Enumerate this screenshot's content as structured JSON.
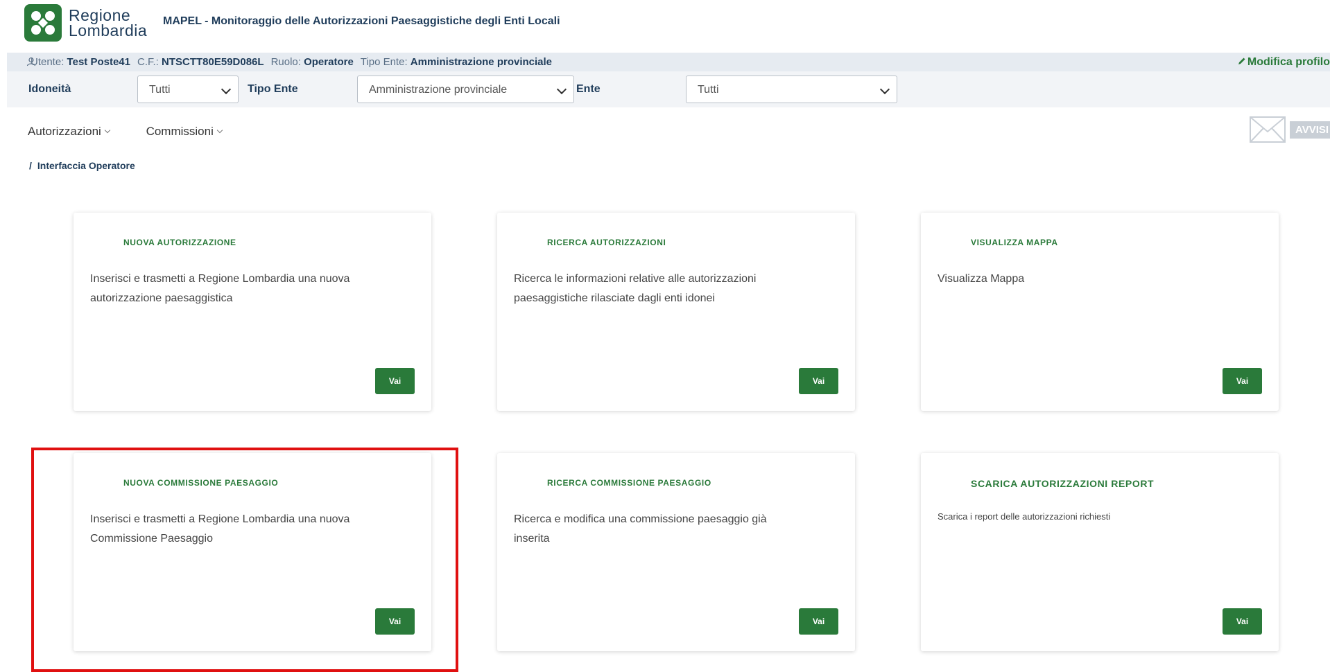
{
  "header": {
    "logo_line1": "Regione",
    "logo_line2": "Lombardia",
    "app_title": "MAPEL - Monitoraggio delle Autorizzazioni Paesaggistiche degli Enti Locali"
  },
  "userbar": {
    "utente_label": "Utente:",
    "utente_value": "Test Poste41",
    "cf_label": "C.F.:",
    "cf_value": "NTSCTT80E59D086L",
    "ruolo_label": "Ruolo:",
    "ruolo_value": "Operatore",
    "tipo_ente_label": "Tipo Ente:",
    "tipo_ente_value": "Amministrazione provinciale",
    "modifica_profilo": "Modifica profilo"
  },
  "filters": {
    "idoneita_label": "Idoneità",
    "idoneita_value": "Tutti",
    "tipo_ente_label": "Tipo Ente",
    "tipo_ente_value": "Amministrazione provinciale",
    "ente_label": "Ente",
    "ente_value": "Tutti"
  },
  "nav": {
    "autorizzazioni": "Autorizzazioni",
    "commissioni": "Commissioni",
    "avvisi": "AVVISI"
  },
  "breadcrumb": {
    "sep": "/",
    "current": "Interfaccia Operatore"
  },
  "cards": [
    {
      "title": "NUOVA AUTORIZZAZIONE",
      "desc": "Inserisci e trasmetti a Regione Lombardia una nuova autorizzazione paesaggistica",
      "button": "Vai"
    },
    {
      "title": "RICERCA AUTORIZZAZIONI",
      "desc": "Ricerca le informazioni relative alle autorizzazioni paesaggistiche rilasciate dagli enti idonei",
      "button": "Vai"
    },
    {
      "title": "VISUALIZZA MAPPA",
      "desc": "Visualizza Mappa",
      "button": "Vai"
    },
    {
      "title": "NUOVA COMMISSIONE PAESAGGIO",
      "desc": "Inserisci e trasmetti a Regione Lombardia una nuova Commissione Paesaggio",
      "button": "Vai"
    },
    {
      "title": "RICERCA COMMISSIONE PAESAGGIO",
      "desc": "Ricerca e modifica una commissione paesaggio già inserita",
      "button": "Vai"
    },
    {
      "title": "SCARICA AUTORIZZAZIONI REPORT",
      "desc": "Scarica i report delle autorizzazioni richiesti",
      "button": "Vai"
    }
  ],
  "colors": {
    "brand_green": "#2a7a3a",
    "dark_blue": "#1f3c5a",
    "highlight_red": "#e01010"
  }
}
